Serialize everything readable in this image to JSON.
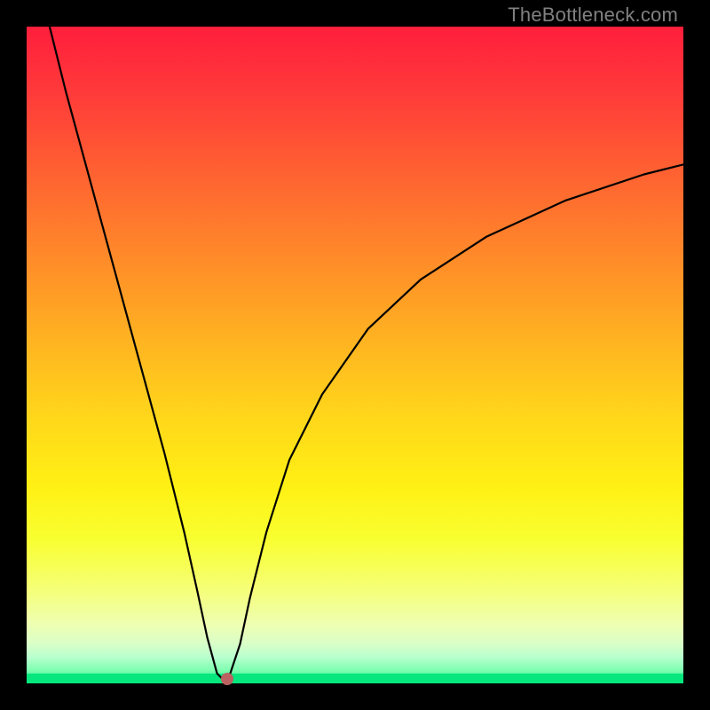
{
  "watermark": "TheBottleneck.com",
  "colors": {
    "background_frame": "#000000",
    "gradient_top": "#ff1e3c",
    "gradient_bottom": "#06e77e",
    "curve": "#000000",
    "marker": "#bb6161"
  },
  "chart_data": {
    "type": "line",
    "title": "",
    "xlabel": "",
    "ylabel": "",
    "xlim": [
      0,
      100
    ],
    "ylim": [
      0,
      100
    ],
    "grid": false,
    "legend": false,
    "series": [
      {
        "name": "bottleneck-curve",
        "x": [
          3.5,
          6.0,
          9.0,
          12.0,
          15.0,
          18.0,
          21.0,
          24.0,
          26.0,
          27.5,
          29.0,
          30.0,
          31.0,
          32.5,
          34.0,
          36.5,
          40.0,
          45.0,
          52.0,
          60.0,
          70.0,
          82.0,
          94.0,
          100.0
        ],
        "values": [
          100.0,
          90.0,
          79.0,
          68.0,
          57.0,
          46.0,
          35.0,
          23.0,
          14.0,
          7.0,
          1.5,
          0.5,
          1.5,
          6.0,
          13.0,
          23.0,
          34.0,
          44.0,
          54.0,
          61.5,
          68.0,
          73.5,
          77.5,
          79.0
        ]
      }
    ],
    "marker": {
      "x": 30.5,
      "y": 0.7
    },
    "green_band_height_pct": 1.5
  }
}
